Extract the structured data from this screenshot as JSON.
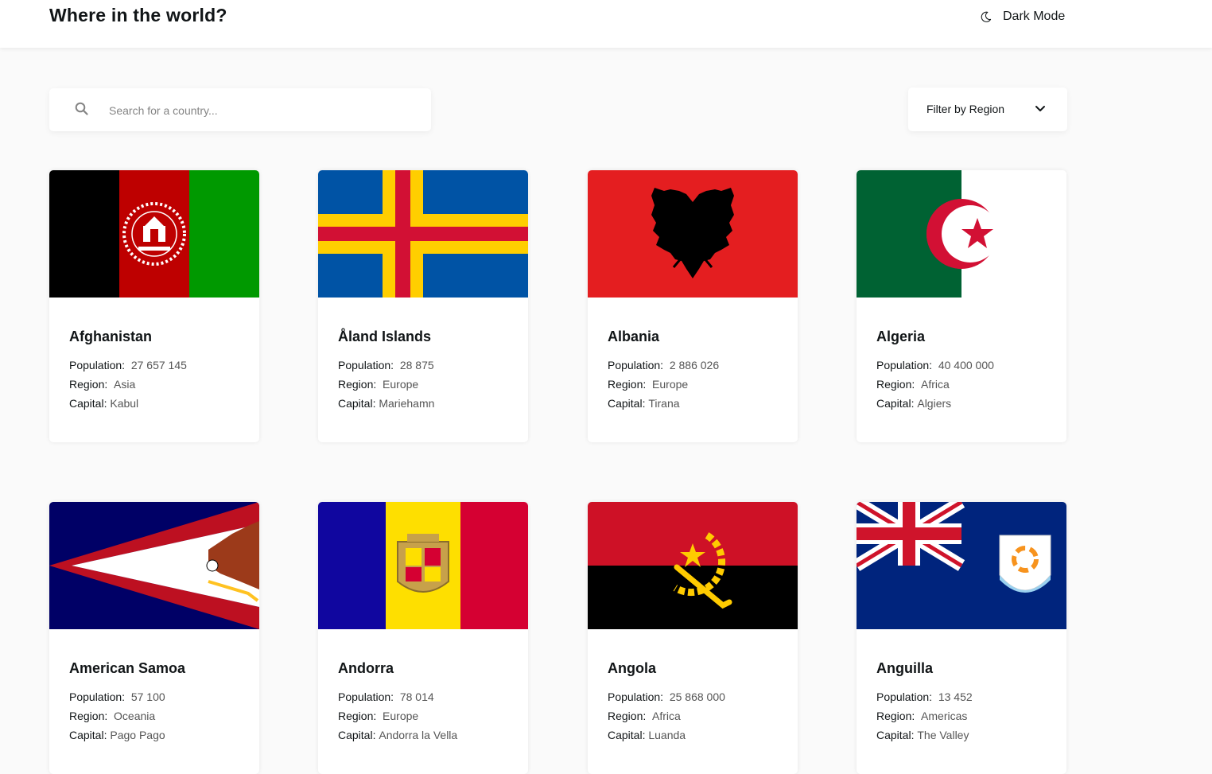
{
  "header": {
    "title": "Where in the world?",
    "theme_toggle_label": "Dark Mode"
  },
  "search": {
    "placeholder": "Search for a country...",
    "value": ""
  },
  "filter": {
    "label": "Filter by Region"
  },
  "labels": {
    "population": "Population:",
    "region": "Region:",
    "capital": "Capital:"
  },
  "colors": {
    "background": "#fafafa",
    "card": "#ffffff",
    "text": "#111517",
    "muted": "#848484"
  },
  "countries": [
    {
      "name": "Afghanistan",
      "population": "27 657 145",
      "region": "Asia",
      "capital": "Kabul"
    },
    {
      "name": "Åland Islands",
      "population": "28 875",
      "region": "Europe",
      "capital": "Mariehamn"
    },
    {
      "name": "Albania",
      "population": "2 886 026",
      "region": "Europe",
      "capital": "Tirana"
    },
    {
      "name": "Algeria",
      "population": "40 400 000",
      "region": "Africa",
      "capital": "Algiers"
    },
    {
      "name": "American Samoa",
      "population": "57 100",
      "region": "Oceania",
      "capital": "Pago Pago"
    },
    {
      "name": "Andorra",
      "population": "78 014",
      "region": "Europe",
      "capital": "Andorra la Vella"
    },
    {
      "name": "Angola",
      "population": "25 868 000",
      "region": "Africa",
      "capital": "Luanda"
    },
    {
      "name": "Anguilla",
      "population": "13 452",
      "region": "Americas",
      "capital": "The Valley"
    }
  ]
}
